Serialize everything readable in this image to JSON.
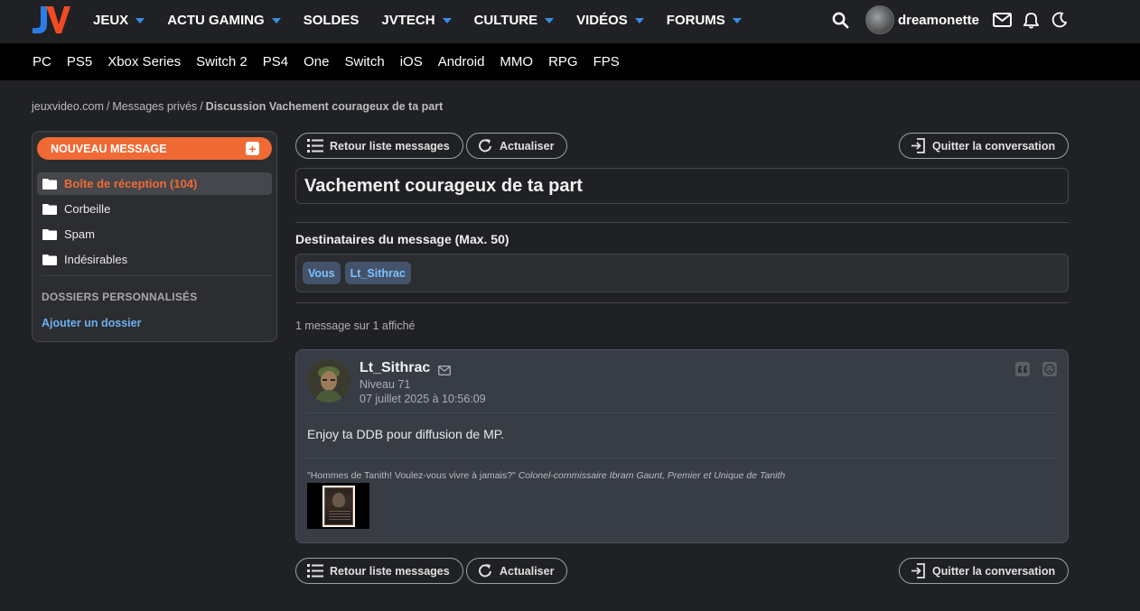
{
  "header": {
    "logo_text": "JV",
    "nav": [
      {
        "label": "JEUX",
        "caret": true
      },
      {
        "label": "ACTU GAMING",
        "caret": true
      },
      {
        "label": "SOLDES",
        "caret": false
      },
      {
        "label": "JVTECH",
        "caret": true
      },
      {
        "label": "CULTURE",
        "caret": true
      },
      {
        "label": "VIDÉOS",
        "caret": true
      },
      {
        "label": "FORUMS",
        "caret": true
      }
    ],
    "username": "dreamonette",
    "icons": [
      "search-icon",
      "mail-icon",
      "bell-icon",
      "moon-icon"
    ]
  },
  "platforms": [
    "PC",
    "PS5",
    "Xbox Series",
    "Switch 2",
    "PS4",
    "One",
    "Switch",
    "iOS",
    "Android",
    "MMO",
    "RPG",
    "FPS"
  ],
  "breadcrumb": {
    "items": [
      "jeuxvideo.com",
      "Messages privés"
    ],
    "current": "Discussion Vachement courageux de ta part",
    "separator": "/"
  },
  "sidebar": {
    "new_message_label": "NOUVEAU MESSAGE",
    "folders": [
      {
        "label": "Boîte de réception (104)",
        "active": true
      },
      {
        "label": "Corbeille",
        "active": false
      },
      {
        "label": "Spam",
        "active": false
      },
      {
        "label": "Indésirables",
        "active": false
      }
    ],
    "custom_heading": "DOSSIERS PERSONNALISÉS",
    "add_folder_label": "Ajouter un dossier"
  },
  "toolbar": {
    "back_label": "Retour liste messages",
    "refresh_label": "Actualiser",
    "leave_label": "Quitter la conversation"
  },
  "conversation": {
    "subject": "Vachement courageux de ta part",
    "recipients_label": "Destinataires du message (Max. 50)",
    "recipients": [
      "Vous",
      "Lt_Sithrac"
    ],
    "count_text": "1 message sur 1 affiché"
  },
  "message": {
    "author": "Lt_Sithrac",
    "level": "Niveau 71",
    "date": "07 juillet 2025 à 10:56:09",
    "body": "Enjoy ta DDB pour diffusion de MP.",
    "signature_quote": "\"Hommes de Tanith! Voulez-vous vivre à jamais?\"",
    "signature_author": "Colonel-commissaire Ibram Gaunt, Premier et Unique de Tanith"
  },
  "colors": {
    "accent": "#f06a35",
    "link": "#6bb0f0",
    "chip_text": "#7fc0ff",
    "background": "#202124"
  }
}
